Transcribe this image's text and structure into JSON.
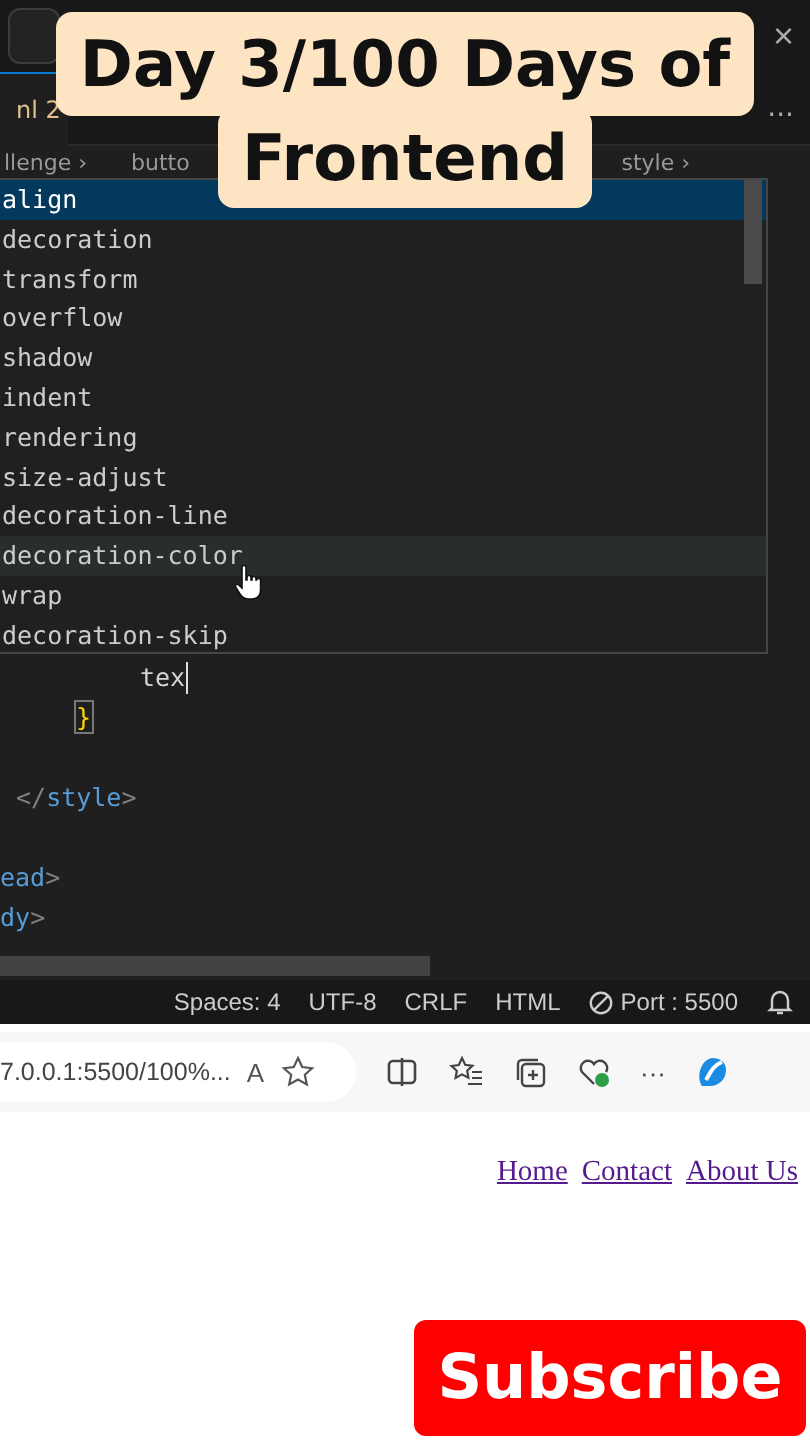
{
  "video_title": {
    "lines": [
      "Day 3/100 Days of",
      "Frontend"
    ]
  },
  "editor": {
    "close_label": "×",
    "tab_label": "nl 2",
    "more_label": "...",
    "breadcrumbs": [
      "llenge ›",
      "butto",
      "style ›"
    ],
    "suggestions": [
      {
        "label": "align",
        "selected": true,
        "hovered": false
      },
      {
        "label": "decoration",
        "selected": false,
        "hovered": false
      },
      {
        "label": "transform",
        "selected": false,
        "hovered": false
      },
      {
        "label": "overflow",
        "selected": false,
        "hovered": false
      },
      {
        "label": "shadow",
        "selected": false,
        "hovered": false
      },
      {
        "label": "indent",
        "selected": false,
        "hovered": false
      },
      {
        "label": "rendering",
        "selected": false,
        "hovered": false
      },
      {
        "label": "size-adjust",
        "selected": false,
        "hovered": false
      },
      {
        "label": "decoration-line",
        "selected": false,
        "hovered": false
      },
      {
        "label": "decoration-color",
        "selected": false,
        "hovered": true
      },
      {
        "label": "wrap",
        "selected": false,
        "hovered": false
      },
      {
        "label": "decoration-skip",
        "selected": false,
        "hovered": false
      }
    ],
    "code_lines": [
      {
        "kind": "declaration",
        "cursor": true,
        "tokens": [
          {
            "kind": "text",
            "text": "tex"
          }
        ]
      },
      {
        "kind": "brace",
        "cursor": false,
        "tokens": [
          {
            "kind": "bracket",
            "text": "}"
          }
        ]
      },
      {
        "kind": "blank",
        "cursor": false
      },
      {
        "kind": "style-tag",
        "cursor": false,
        "tokens": [
          {
            "kind": "punct",
            "text": "</"
          },
          {
            "kind": "tag",
            "text": "style"
          },
          {
            "kind": "punct",
            "text": ">"
          }
        ]
      },
      {
        "kind": "blank",
        "cursor": false
      },
      {
        "kind": "html-tag",
        "cursor": false,
        "tokens": [
          {
            "kind": "tag",
            "text": "ead"
          },
          {
            "kind": "punct",
            "text": ">"
          }
        ]
      },
      {
        "kind": "html-tag",
        "cursor": false,
        "tokens": [
          {
            "kind": "tag",
            "text": "dy"
          },
          {
            "kind": "punct",
            "text": ">"
          }
        ]
      }
    ],
    "status_items": [
      {
        "kind": "text",
        "label": "Spaces: 4"
      },
      {
        "kind": "text",
        "label": "UTF-8"
      },
      {
        "kind": "text",
        "label": "CRLF"
      },
      {
        "kind": "text",
        "label": "HTML"
      },
      {
        "kind": "port",
        "label": "Port : 5500"
      },
      {
        "kind": "bell"
      }
    ]
  },
  "browser": {
    "url": "7.0.0.1:5500/100%...",
    "read_aloud": "A",
    "more_label": "···"
  },
  "page": {
    "nav_links": [
      "Home",
      "Contact",
      "About Us"
    ]
  },
  "subscribe_button": "Subscribe"
}
